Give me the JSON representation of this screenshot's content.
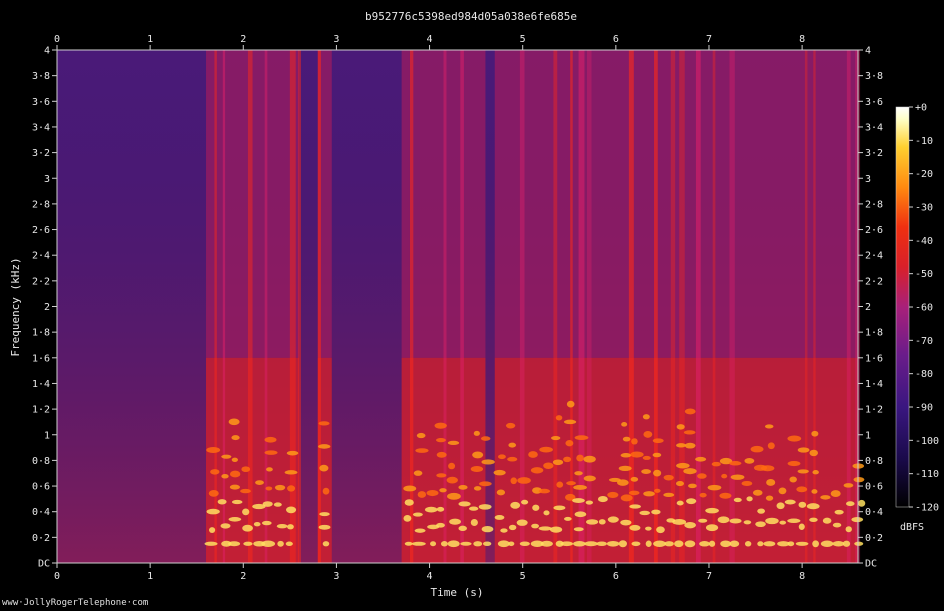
{
  "chart_data": {
    "type": "heatmap",
    "title": "b952776c5398ed984d05a038e6fe685e",
    "xlabel": "Time (s)",
    "ylabel": "Frequency (kHz)",
    "xlim": [
      0,
      8.6
    ],
    "ylim": [
      0,
      4
    ],
    "x_ticks": [
      "0",
      "1",
      "2",
      "3",
      "4",
      "5",
      "6",
      "7",
      "8"
    ],
    "y_ticks": [
      "DC",
      "0·2",
      "0·4",
      "0·6",
      "0·8",
      "1",
      "1·2",
      "1·4",
      "1·6",
      "1·8",
      "2",
      "2·2",
      "2·4",
      "2·6",
      "2·8",
      "3",
      "3·2",
      "3·4",
      "3·6",
      "3·8",
      "4"
    ],
    "colorbar": {
      "label": "dBFS",
      "range": [
        -120,
        0
      ],
      "ticks": [
        "+0",
        "-10",
        "-20",
        "-30",
        "-40",
        "-50",
        "-60",
        "-70",
        "-80",
        "-90",
        "-100",
        "-110",
        "-120"
      ]
    },
    "colormap": [
      "#000000",
      "#1a0a4a",
      "#3a1680",
      "#6a1c8a",
      "#a8207a",
      "#d8202a",
      "#f03010",
      "#ff8a10",
      "#ffd030",
      "#ffffc8",
      "#ffffff"
    ],
    "speech_segments_s": [
      [
        1.6,
        2.6
      ],
      [
        2.8,
        2.95
      ],
      [
        3.7,
        4.6
      ],
      [
        4.7,
        8.6
      ]
    ],
    "harmonic_band_khz": [
      0.15,
      1.6
    ]
  },
  "footer": "www·JollyRogerTelephone·com"
}
